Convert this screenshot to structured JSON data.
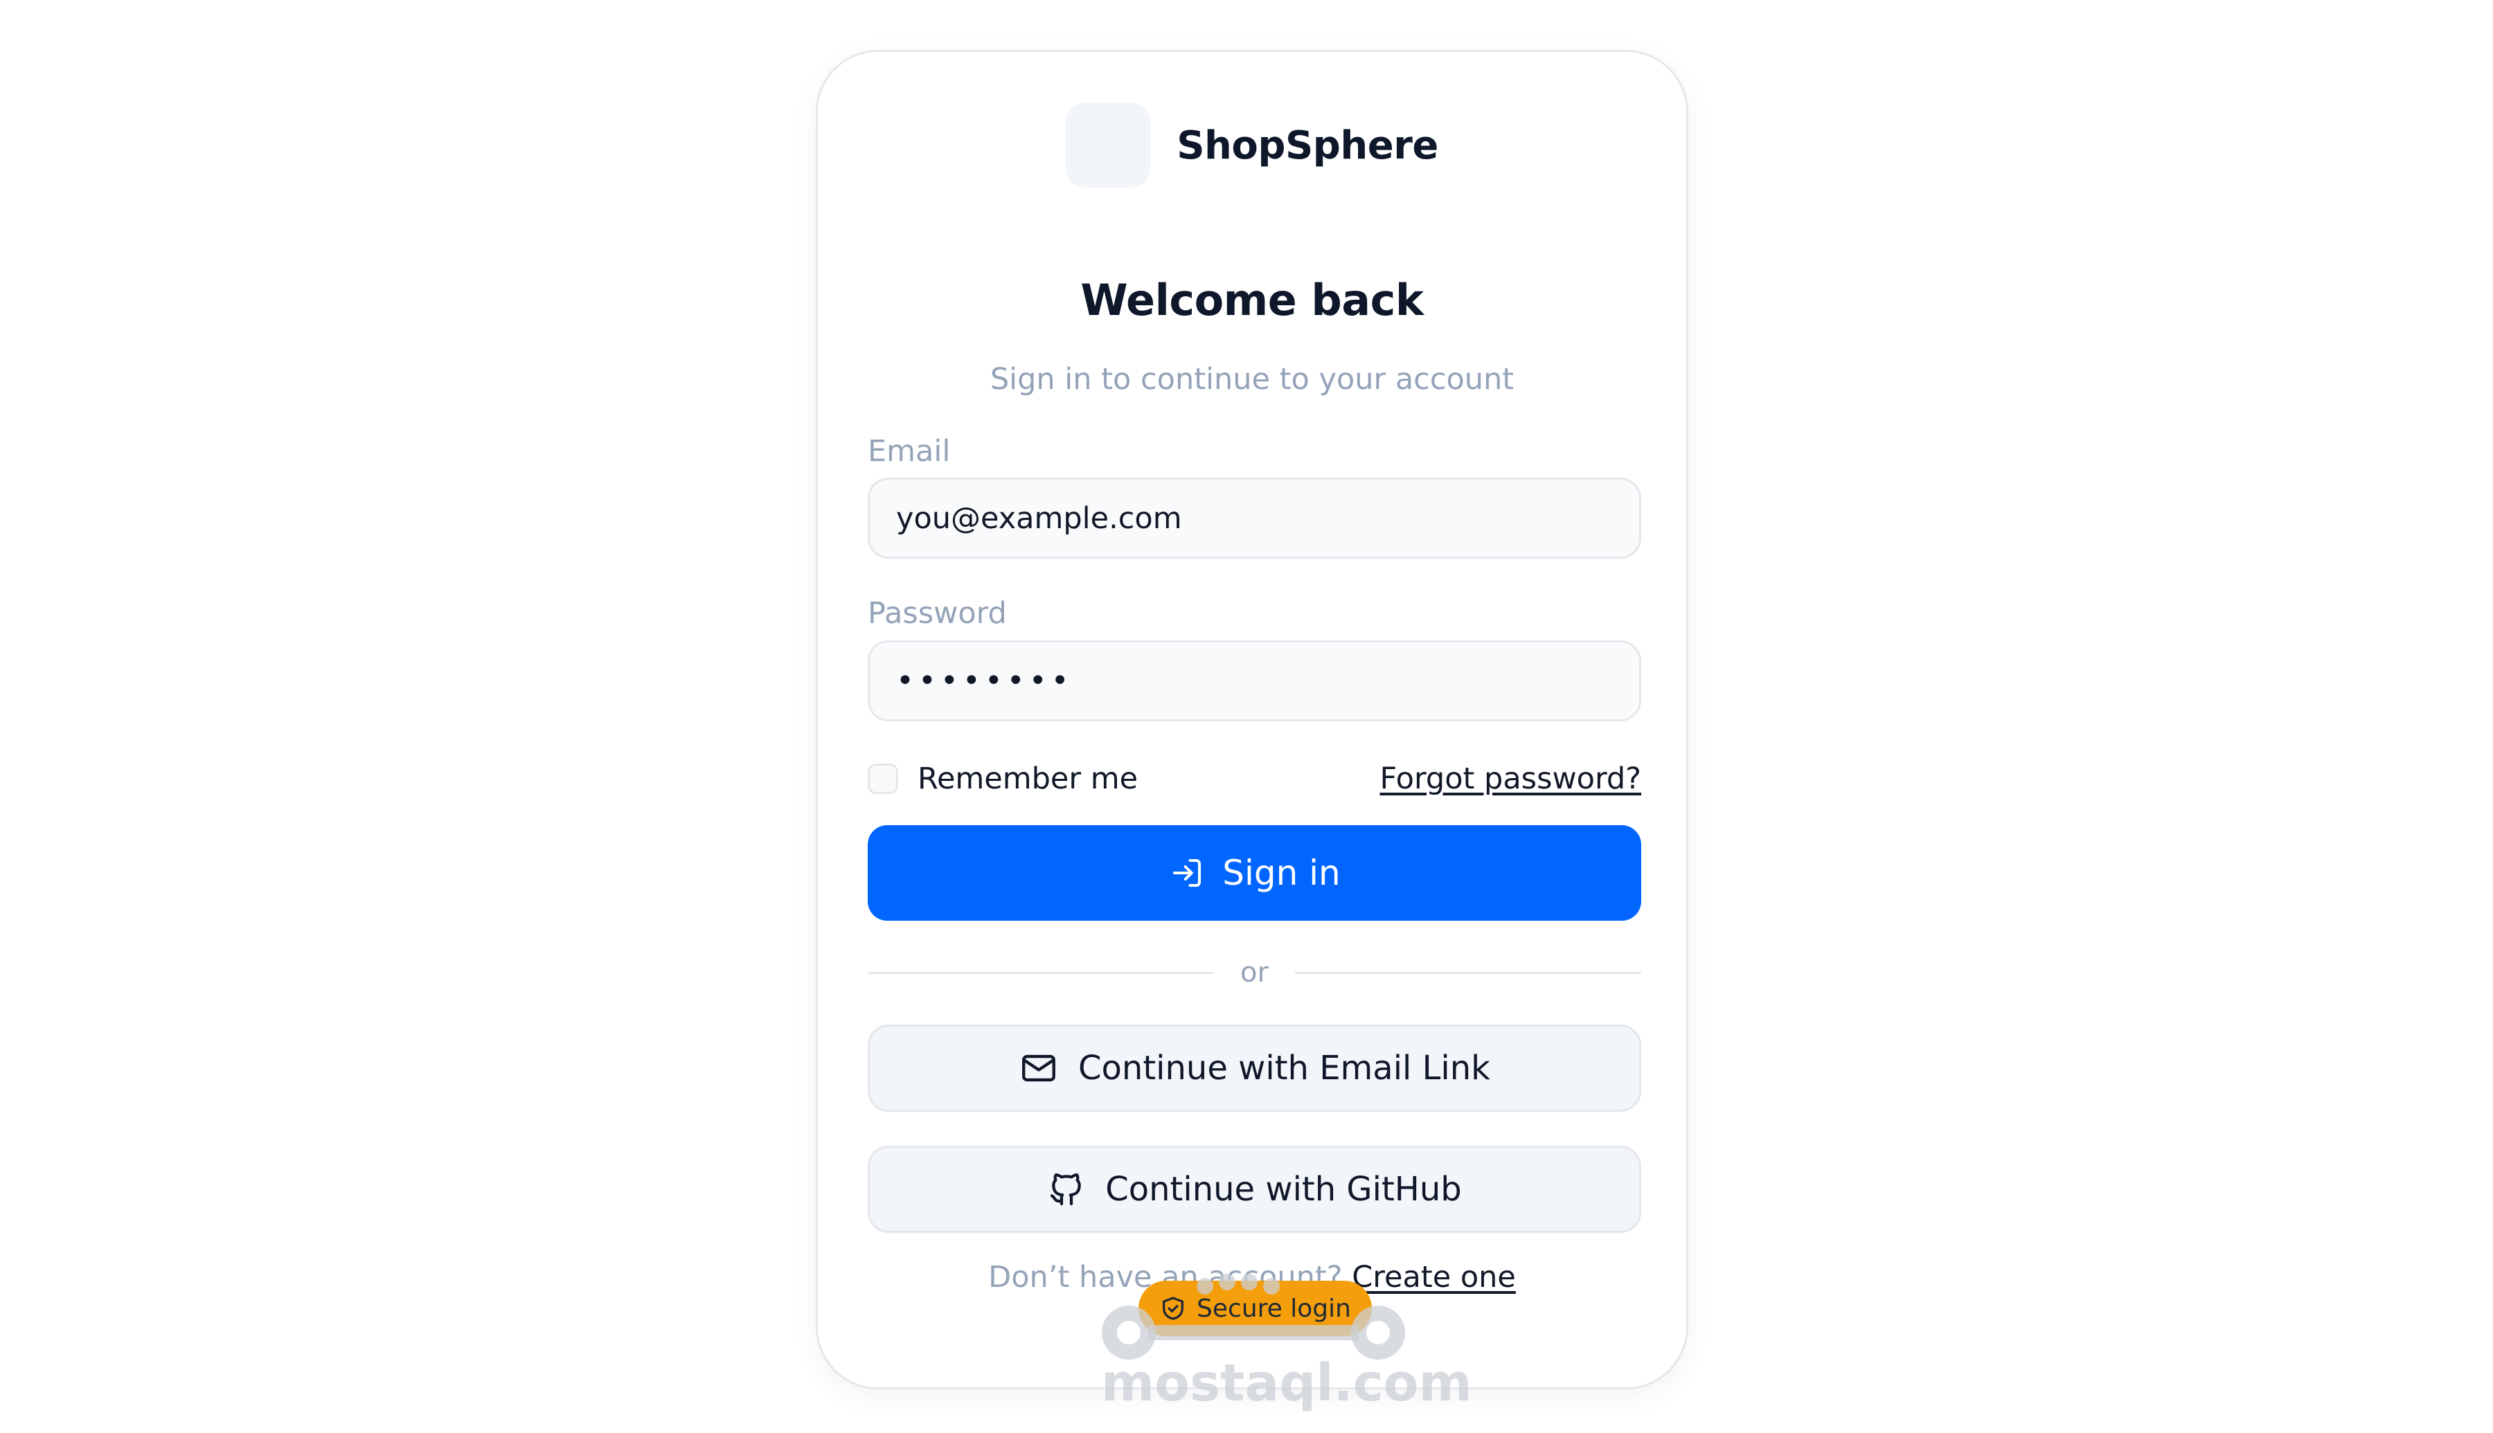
{
  "brand": {
    "name": "ShopSphere"
  },
  "header": {
    "title": "Welcome back",
    "subtitle": "Sign in to continue to your account"
  },
  "form": {
    "email_label": "Email",
    "email_value": "you@example.com",
    "password_label": "Password",
    "password_value": "••••••••",
    "remember_label": "Remember me",
    "remember_checked": false,
    "forgot_label": "Forgot password?",
    "signin_label": "Sign in"
  },
  "divider": {
    "text": "or"
  },
  "alt_auth": {
    "email_link_label": "Continue with Email Link",
    "github_label": "Continue with GitHub"
  },
  "signup": {
    "prompt": "Don’t have an account?",
    "link_label": "Create one"
  },
  "badge": {
    "label": "Secure login"
  },
  "watermark": {
    "text": "mostaql.com"
  },
  "colors": {
    "primary": "#0066ff",
    "badge": "#f59e0b",
    "muted_text": "#94a3b8",
    "text": "#0f172a",
    "border": "#e5e7eb",
    "surface": "#f2f5f9"
  },
  "icons": {
    "signin": "sign-in-icon",
    "email": "mail-icon",
    "github": "github-icon",
    "badge": "shield-check-icon"
  }
}
